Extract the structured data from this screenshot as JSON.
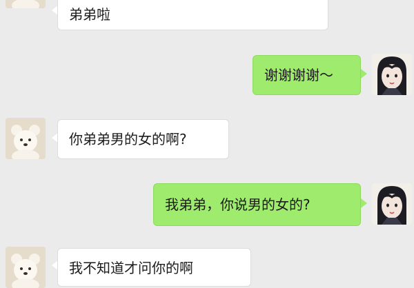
{
  "messages": [
    {
      "sender": "friend",
      "text": "弟弟啦"
    },
    {
      "sender": "me",
      "text": "谢谢谢谢～"
    },
    {
      "sender": "friend",
      "text": "你弟弟男的女的啊?"
    },
    {
      "sender": "me",
      "text": "我弟弟，你说男的女的?"
    },
    {
      "sender": "friend",
      "text": "我不知道才问你的啊"
    }
  ],
  "avatars": {
    "friend": "teddy-bear-avatar-icon",
    "me": "cartoon-girl-avatar-icon"
  },
  "colors": {
    "background": "#ebebeb",
    "incoming_bubble": "#ffffff",
    "outgoing_bubble": "#9feb6e"
  }
}
